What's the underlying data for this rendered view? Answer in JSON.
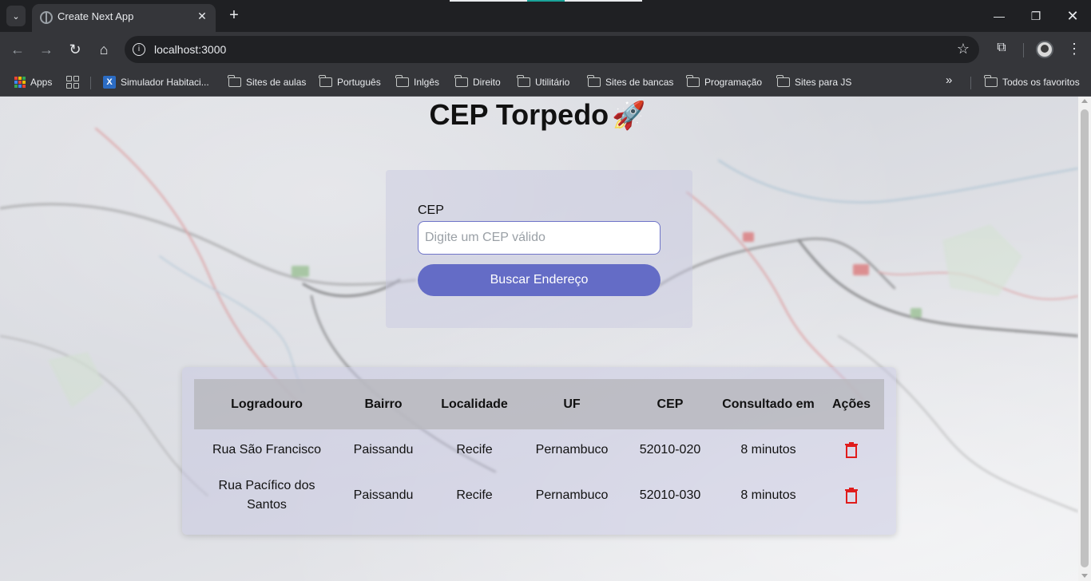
{
  "browser": {
    "tab_title": "Create Next App",
    "url": "localhost:3000",
    "bookmarks": [
      {
        "label": "Apps",
        "icon": "apps-icon"
      },
      {
        "label": "",
        "icon": "grid-icon"
      },
      {
        "label": "Simulador Habitaci...",
        "icon": "caixa-icon"
      },
      {
        "label": "Sites de aulas",
        "icon": "folder-icon"
      },
      {
        "label": "Português",
        "icon": "folder-icon"
      },
      {
        "label": "Inlgês",
        "icon": "folder-icon"
      },
      {
        "label": "Direito",
        "icon": "folder-icon"
      },
      {
        "label": "Utilitário",
        "icon": "folder-icon"
      },
      {
        "label": "Sites de bancas",
        "icon": "folder-icon"
      },
      {
        "label": "Programação",
        "icon": "folder-icon"
      },
      {
        "label": "Sites para JS",
        "icon": "folder-icon"
      }
    ],
    "all_bookmarks_label": "Todos os favoritos"
  },
  "page": {
    "title": "CEP Torpedo",
    "title_emoji": "🚀",
    "search": {
      "label": "CEP",
      "placeholder": "Digite um CEP válido",
      "value": "",
      "button_label": "Buscar Endereço"
    },
    "table": {
      "headers": [
        "Logradouro",
        "Bairro",
        "Localidade",
        "UF",
        "CEP",
        "Consultado em",
        "Ações"
      ],
      "rows": [
        {
          "logradouro": "Rua São Francisco",
          "bairro": "Paissandu",
          "localidade": "Recife",
          "uf": "Pernambuco",
          "cep": "52010-020",
          "consultado": "8 minutos",
          "action_icon": "trash-icon"
        },
        {
          "logradouro": "Rua Pacífico dos Santos",
          "bairro": "Paissandu",
          "localidade": "Recife",
          "uf": "Pernambuco",
          "cep": "52010-030",
          "consultado": "8 minutos",
          "action_icon": "trash-icon"
        }
      ]
    }
  },
  "colors": {
    "button": "#646cc6",
    "delete_icon": "#e01c1c",
    "browser_frame": "#35363a"
  }
}
